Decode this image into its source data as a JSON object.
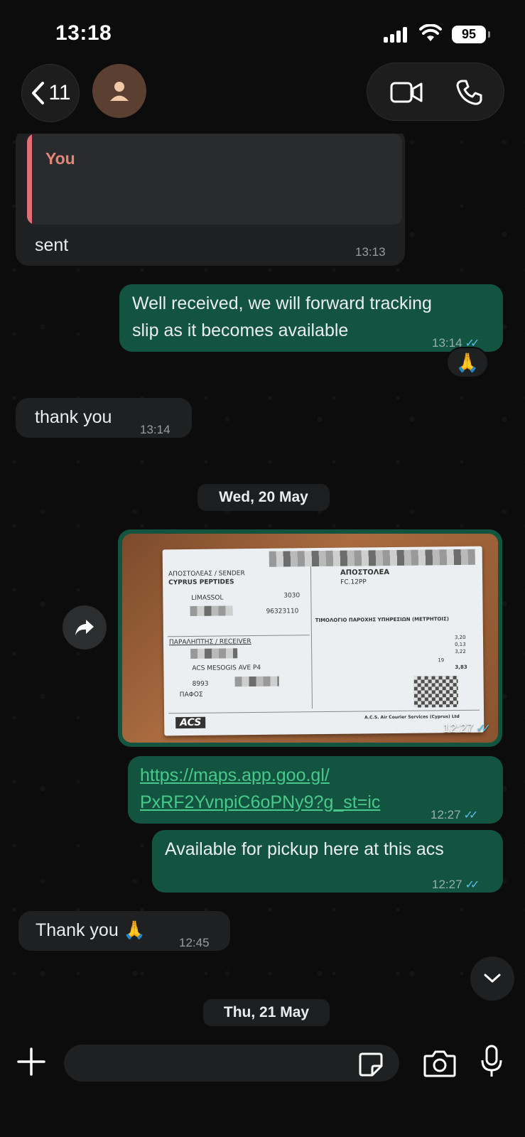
{
  "status_bar": {
    "time": "13:18",
    "battery": "95"
  },
  "header": {
    "back_count": "11"
  },
  "messages": {
    "m1": {
      "quote_author": "You",
      "text": "sent",
      "time": "13:13"
    },
    "m2": {
      "text_line1": "Well received, we will forward tracking",
      "text_line2": "slip as it becomes available",
      "time": "13:14",
      "reaction": "🙏"
    },
    "m3": {
      "text": "thank you",
      "time": "13:14"
    },
    "date1": "Wed, 20 May",
    "photo": {
      "time": "12:27",
      "slip": {
        "sender_label": "ΑΠΟΣΤΟΛΕΑΣ / SENDER",
        "sender_name": "CYPRUS PEPTIDES",
        "sender_city": "LIMASSOL",
        "zip": "3030",
        "phone": "96323110",
        "receiver_label": "ΠΑΡΑΛΗΠΤΗΣ / RECEIVER",
        "receiver_address": "ACS MESOGIS AVE P4",
        "receiver_zip": "8993",
        "receiver_city": "ΠΑΦΟΣ",
        "debit_label": "ΑΠΟΣΤΟΛΕΑ",
        "product": "FC.12PP",
        "invoice_title": "ΤΙΜΟΛΟΓΙΟ ΠΑΡΟΧΗΣ ΥΠΗΡΕΣΙΩΝ (ΜΕΤΡΗΤΟΙΣ)",
        "charge1": "3,20",
        "charge2": "0,13",
        "charge3": "3,22",
        "vat": "19",
        "total": "3,83",
        "brand": "ACS",
        "company": "A.C.S. Air Courier Services (Cyprus) Ltd"
      }
    },
    "m4": {
      "link_line1": "https://maps.app.goo.gl/",
      "link_line2": "PxRF2YvnpiC6oPNy9?g_st=ic",
      "time": "12:27"
    },
    "m5": {
      "text": "Available for pickup here at this acs",
      "time": "12:27"
    },
    "m6": {
      "text": "Thank you 🙏",
      "time": "12:45"
    },
    "date2": "Thu, 21 May"
  },
  "composer": {
    "value": "",
    "placeholder": ""
  },
  "icons": [
    "chevron-left-icon",
    "person-icon",
    "video-icon",
    "phone-icon",
    "forward-icon",
    "chevron-down-icon",
    "plus-icon",
    "sticker-icon",
    "camera-icon",
    "mic-icon"
  ],
  "colors": {
    "outgoing": "#135440",
    "incoming": "#1f2021",
    "link": "#48c98a",
    "read_ticks": "#53bdeb",
    "quote_bar": "#e26e7a"
  }
}
